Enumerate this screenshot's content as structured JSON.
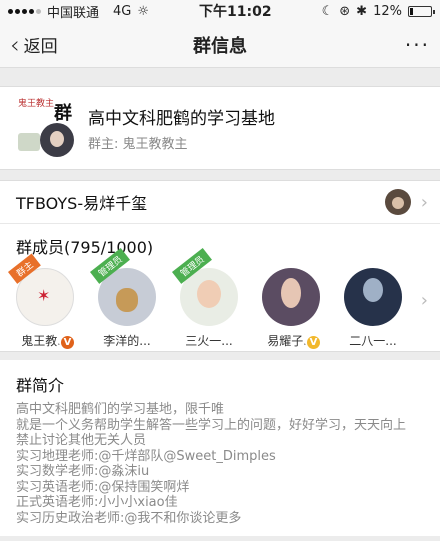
{
  "status_bar": {
    "carrier": "中国联通",
    "network": "4G",
    "time": "下午11:02",
    "battery": "12%",
    "battery_fraction": 0.12
  },
  "nav": {
    "back_label": "返回",
    "title": "群信息",
    "more_label": "···"
  },
  "group": {
    "name": "高中文科肥鹤的学习基地",
    "owner": "群主: 鬼王教教主",
    "avatar_brush_text": "群",
    "avatar_seal_text": "鬼王教主"
  },
  "featured_member": {
    "label": "TFBOYS-易烊千玺"
  },
  "members": {
    "title": "群成员(795/1000)",
    "items": [
      {
        "name": "鬼王教...",
        "ribbon": "群主",
        "ribbon_color": "#e8702a",
        "badge": "V"
      },
      {
        "name": "李洋的...",
        "ribbon": "管理员",
        "ribbon_color": "#4caf50",
        "badge": ""
      },
      {
        "name": "三火一...",
        "ribbon": "管理员",
        "ribbon_color": "#4caf50",
        "badge": ""
      },
      {
        "name": "易耀子...",
        "ribbon": "",
        "ribbon_color": "",
        "badge": "V"
      },
      {
        "name": "二八一...",
        "ribbon": "",
        "ribbon_color": "",
        "badge": ""
      }
    ]
  },
  "intro": {
    "title": "群简介",
    "lines": [
      "高中文科肥鹤们的学习基地，限千唯",
      "就是一个义务帮助学生解答一些学习上的问题，好好学习，天天向上",
      "禁止讨论其他无关人员",
      "实习地理老师:@千烊部队@Sweet_Dimples",
      "实习数学老师:@淼沫iu",
      "实习英语老师:@保持围笑啊烊",
      "正式英语老师:小小小xiao佳",
      "实习历史政治老师:@我不和你谈论更多"
    ]
  },
  "colors": {
    "background": "#ececec",
    "vip_badge": "#e0621a",
    "gold_badge": "#f2b82c",
    "admin_ribbon": "#4caf50",
    "owner_ribbon": "#e8702a"
  }
}
